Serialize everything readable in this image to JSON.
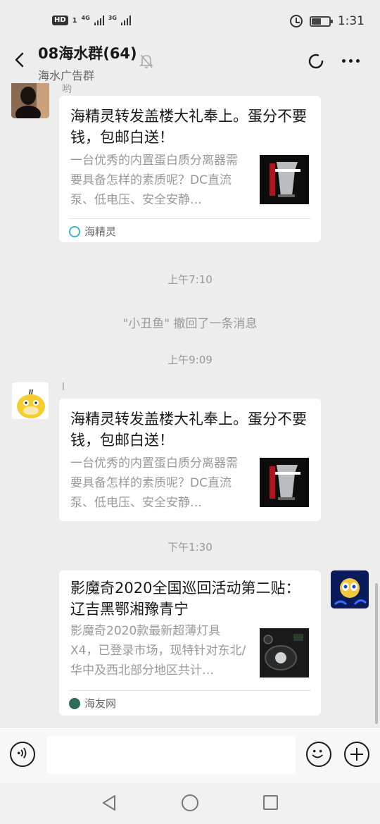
{
  "status_bar": {
    "hd": "HD",
    "sim1": "1",
    "net1": "4G",
    "net2": "3G",
    "time": "1:31",
    "battery_level": 0.55
  },
  "header": {
    "title": "08海水群(64)",
    "subtitle": "海水广告群"
  },
  "messages": [
    {
      "sender_name": "哟",
      "card": {
        "title": "海精灵转发盖楼大礼奉上。蛋分不要钱，包邮白送！",
        "description": "一台优秀的内置蛋白质分离器需要具备怎样的素质呢？DC直流泵、低电压、安全安静…",
        "source": "海精灵"
      }
    },
    {
      "sender_name": "l",
      "card": {
        "title": "海精灵转发盖楼大礼奉上。蛋分不要钱，包邮白送！",
        "description": "一台优秀的内置蛋白质分离器需要具备怎样的素质呢？DC直流泵、低电压、安全安静…"
      }
    },
    {
      "card": {
        "title": "影魔奇2020全国巡回活动第二贴： 辽吉黑鄂湘豫青宁",
        "description": "影魔奇2020款最新超薄灯具X4，已登录市场，现特针对东北/华中及西北部分地区共计…",
        "source": "海友网"
      }
    }
  ],
  "timestamps": [
    "上午7:10",
    "上午9:09",
    "下午1:30"
  ],
  "system_message": "\"小丑鱼\" 撤回了一条消息",
  "input": {
    "placeholder": ""
  },
  "colors": {
    "background": "#ededed",
    "card": "#ffffff",
    "muted_text": "#999999"
  }
}
